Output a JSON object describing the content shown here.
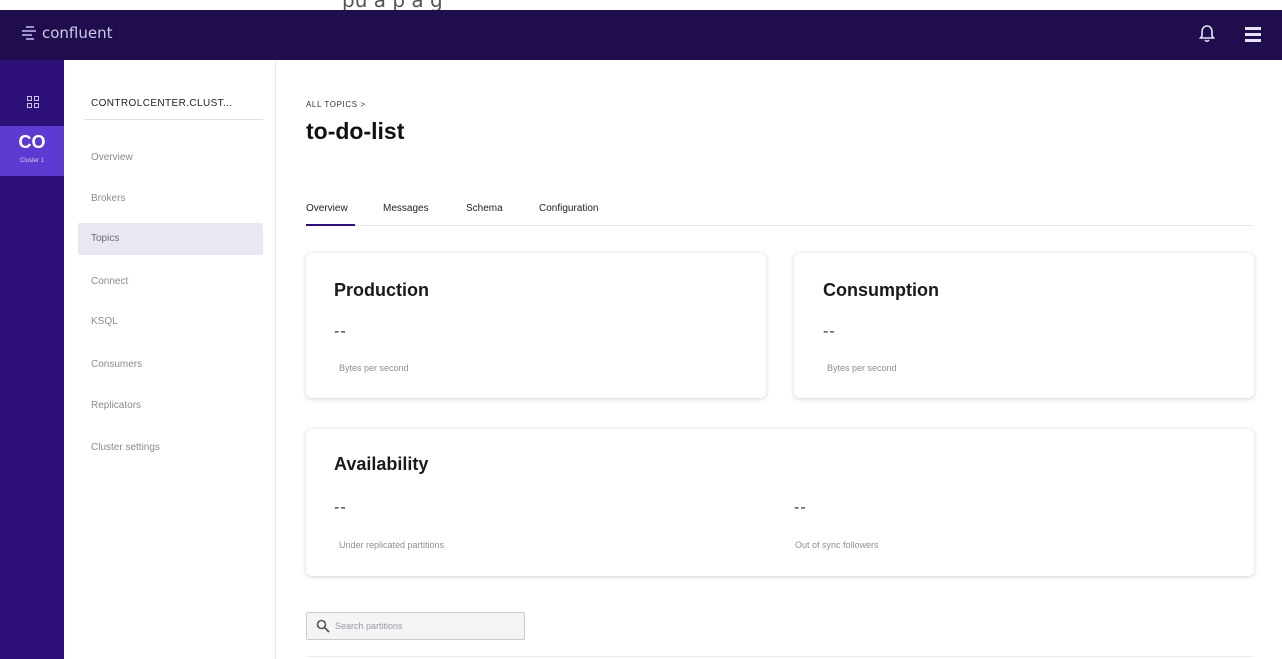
{
  "header_strip": {
    "partial_text": "pu   a   p   a   g"
  },
  "topbar": {
    "brand": "confluent",
    "icons": [
      "bell-icon",
      "menu-icon"
    ]
  },
  "rail": {
    "active_short": "CO",
    "active_cluster": "Cluster 1",
    "icons": [
      "grid-icon"
    ]
  },
  "nav": {
    "cluster_name": "CONTROLCENTER.CLUST...",
    "items": [
      {
        "label": "Overview"
      },
      {
        "label": "Brokers"
      },
      {
        "label": "Topics",
        "active": true
      },
      {
        "label": "Connect"
      },
      {
        "label": "KSQL"
      },
      {
        "label": "Consumers"
      },
      {
        "label": "Replicators"
      },
      {
        "label": "Cluster settings"
      }
    ]
  },
  "main": {
    "breadcrumb": "ALL TOPICS >",
    "title": "to-do-list",
    "tabs": [
      {
        "label": "Overview",
        "active": true
      },
      {
        "label": "Messages"
      },
      {
        "label": "Schema"
      },
      {
        "label": "Configuration"
      }
    ],
    "production": {
      "title": "Production",
      "value": "--",
      "unit": "Bytes per second"
    },
    "consumption": {
      "title": "Consumption",
      "value": "--",
      "unit": "Bytes per second"
    },
    "availability": {
      "title": "Availability",
      "under_replicated": {
        "value": "--",
        "label": "Under replicated partitions"
      },
      "out_of_sync": {
        "value": "--",
        "label": "Out of sync followers"
      }
    },
    "search": {
      "placeholder": "Search partitions",
      "value": ""
    }
  },
  "colors": {
    "topbar": "#1f0d4d",
    "rail": "#2d0f7a",
    "rail_active": "#5d3bd0",
    "nav_active_bg": "#e9e8f2",
    "tab_underline": "#2d0f7a"
  }
}
